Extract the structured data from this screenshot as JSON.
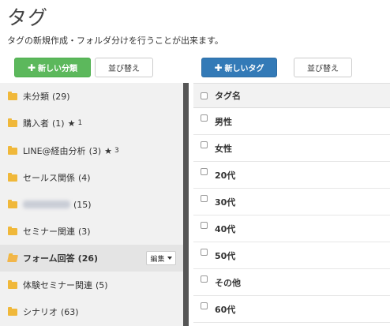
{
  "page": {
    "title": "タグ",
    "description": "タグの新規作成・フォルダ分けを行うことが出来ます。"
  },
  "toolbar": {
    "new_folder_label": "新しい分類",
    "sort_folders_label": "並び替え",
    "new_tag_label": "新しいタグ",
    "sort_tags_label": "並び替え",
    "plus_glyph": "✚"
  },
  "folders": [
    {
      "name": "未分類",
      "count": "(29)"
    },
    {
      "name": "購入者",
      "count": "(1)",
      "star": "★",
      "star_count": "1"
    },
    {
      "name": "LINE@経由分析",
      "count": "(3)",
      "star": "★",
      "star_count": "3"
    },
    {
      "name": "セールス関係",
      "count": "(4)"
    },
    {
      "name": "",
      "count": "(15)",
      "blurred": true
    },
    {
      "name": "セミナー関連",
      "count": "(3)"
    },
    {
      "name": "フォーム回答",
      "count": "(26)",
      "active": true,
      "edit_label": "編集"
    },
    {
      "name": "体験セミナー関連",
      "count": "(5)"
    },
    {
      "name": "シナリオ",
      "count": "(63)"
    }
  ],
  "tags": {
    "header": "タグ名",
    "rows": [
      "男性",
      "女性",
      "20代",
      "30代",
      "40代",
      "50代",
      "その他",
      "60代"
    ]
  },
  "colors": {
    "green_button": "#5cb85c",
    "blue_button": "#337ab7",
    "folder_icon": "#f0b83a",
    "divider": "#555555"
  }
}
